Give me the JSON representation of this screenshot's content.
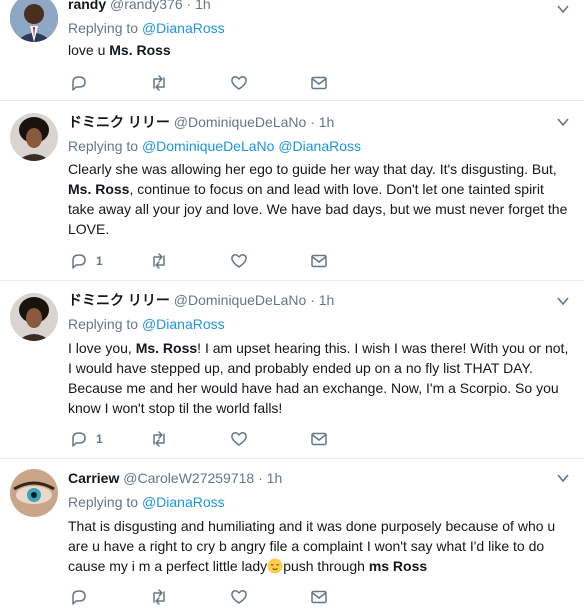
{
  "tweets": [
    {
      "name": "randy",
      "handle": "@randy376",
      "time": "1h",
      "replying_prefix": "Replying to",
      "replying_to": "@DianaRoss",
      "text_parts": [
        "love u ",
        "Ms. Ross"
      ],
      "reply_count": ""
    },
    {
      "name": "ドミニク リリー",
      "handle": "@DominiqueDeLaNo",
      "time": "1h",
      "replying_prefix": "Replying to",
      "replying_to": "@DominiqueDeLaNo @DianaRoss",
      "text_parts": [
        "Clearly she was allowing her ego to guide her way that day. It's disgusting. But,",
        "Ms. Ross",
        ", continue to focus on and lead with love. Don't let one tainted spirit take away all your joy and love. We have bad days, but we must never forget the LOVE."
      ],
      "reply_count": "1"
    },
    {
      "name": "ドミニク リリー",
      "handle": "@DominiqueDeLaNo",
      "time": "1h",
      "replying_prefix": "Replying to",
      "replying_to": "@DianaRoss",
      "text_parts": [
        "I love you, ",
        "Ms. Ross",
        "! I am upset hearing this. I wish I was there! With you or not, I would have stepped up, and probably ended up on a no fly list THAT DAY. Because me and her would have had an exchange. Now, I'm a Scorpio. So you know I won't stop til the world falls!"
      ],
      "reply_count": "1"
    },
    {
      "name": "Carriew",
      "handle": "@CaroleW27259718",
      "time": "1h",
      "replying_prefix": "Replying to",
      "replying_to": "@DianaRoss",
      "text_parts": [
        "That is disgusting and humiliating and it was done purposely because of who u are u have a right to cry b angry file a complaint I won't say what I'd like to do cause my i m a perfect little lady",
        "push through ",
        "ms Ross"
      ],
      "reply_count": ""
    }
  ],
  "separator": "·",
  "icons": {
    "reply": "reply-icon",
    "retweet": "retweet-icon",
    "like": "heart-icon",
    "dm": "envelope-icon",
    "more": "chevron-down-icon",
    "emoji": "relieved-face-emoji"
  },
  "colors": {
    "link": "#1b95e0",
    "secondary": "#657786",
    "icon": "#657786",
    "border": "#e6ecf0"
  }
}
